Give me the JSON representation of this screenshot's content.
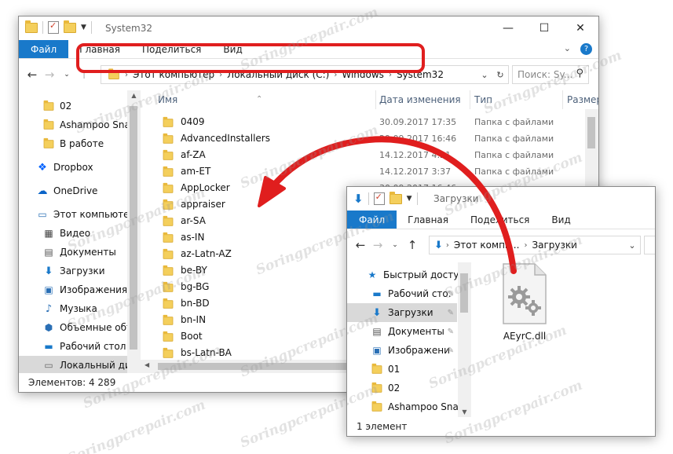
{
  "main_window": {
    "title": "System32",
    "ribbon_tabs": [
      "Файл",
      "Главная",
      "Поделиться",
      "Вид"
    ],
    "breadcrumb": [
      "Этот компьютер",
      "Локальный диск (C:)",
      "Windows",
      "System32"
    ],
    "search_placeholder": "Поиск: Sy...",
    "columns": [
      "Имя",
      "Дата изменения",
      "Тип",
      "Размер"
    ],
    "sidebar": [
      {
        "label": "02",
        "icon": "folder-icon"
      },
      {
        "label": "Ashampoo Snap",
        "icon": "folder-icon"
      },
      {
        "label": "В работе",
        "icon": "folder-icon"
      },
      {
        "label": "Dropbox",
        "icon": "dropbox-icon"
      },
      {
        "label": "OneDrive",
        "icon": "onedrive-icon"
      },
      {
        "label": "Этот компьютер",
        "icon": "computer-icon"
      },
      {
        "label": "Видео",
        "icon": "video-icon"
      },
      {
        "label": "Документы",
        "icon": "documents-icon"
      },
      {
        "label": "Загрузки",
        "icon": "downloads-icon"
      },
      {
        "label": "Изображения",
        "icon": "pictures-icon"
      },
      {
        "label": "Музыка",
        "icon": "music-icon"
      },
      {
        "label": "Объемные объ",
        "icon": "3d-objects-icon"
      },
      {
        "label": "Рабочий стол",
        "icon": "desktop-icon"
      },
      {
        "label": "Локальный дис",
        "icon": "drive-icon"
      }
    ],
    "files": [
      {
        "name": "0409",
        "date": "30.09.2017 17:35",
        "type": "Папка с файлами"
      },
      {
        "name": "AdvancedInstallers",
        "date": "29.09.2017 16:46",
        "type": "Папка с файлами"
      },
      {
        "name": "af-ZA",
        "date": "14.12.2017 4:21",
        "type": "Папка с файлами"
      },
      {
        "name": "am-ET",
        "date": "14.12.2017 3:37",
        "type": "Папка с файлами"
      },
      {
        "name": "AppLocker",
        "date": "30.09.2017 16:46",
        "type": ""
      },
      {
        "name": "appraiser",
        "date": "",
        "type": ""
      },
      {
        "name": "ar-SA",
        "date": "",
        "type": ""
      },
      {
        "name": "as-IN",
        "date": "",
        "type": ""
      },
      {
        "name": "az-Latn-AZ",
        "date": "",
        "type": ""
      },
      {
        "name": "be-BY",
        "date": "",
        "type": ""
      },
      {
        "name": "bg-BG",
        "date": "",
        "type": ""
      },
      {
        "name": "bn-BD",
        "date": "",
        "type": ""
      },
      {
        "name": "bn-IN",
        "date": "",
        "type": ""
      },
      {
        "name": "Boot",
        "date": "",
        "type": ""
      },
      {
        "name": "bs-Latn-BA",
        "date": "",
        "type": ""
      }
    ],
    "status": "Элементов: 4 289"
  },
  "sub_window": {
    "title": "Загрузки",
    "ribbon_tabs": [
      "Файл",
      "Главная",
      "Поделиться",
      "Вид"
    ],
    "breadcrumb": [
      "Этот компь...",
      "Загрузки"
    ],
    "sidebar": [
      {
        "label": "Быстрый доступ",
        "icon": "star-icon"
      },
      {
        "label": "Рабочий сто.",
        "icon": "desktop-icon"
      },
      {
        "label": "Загрузки",
        "icon": "downloads-icon"
      },
      {
        "label": "Документы",
        "icon": "documents-icon"
      },
      {
        "label": "Изображени",
        "icon": "pictures-icon"
      },
      {
        "label": "01",
        "icon": "folder-icon"
      },
      {
        "label": "02",
        "icon": "folder-icon"
      },
      {
        "label": "Ashampoo Snap",
        "icon": "folder-icon"
      }
    ],
    "file_name": "AEyrC.dll",
    "status": "1 элемент"
  },
  "watermark": "Soringpcrepair.com",
  "colors": {
    "accent": "#1979ca",
    "highlight": "#e01e1e",
    "folder": "#f4cf5c"
  }
}
